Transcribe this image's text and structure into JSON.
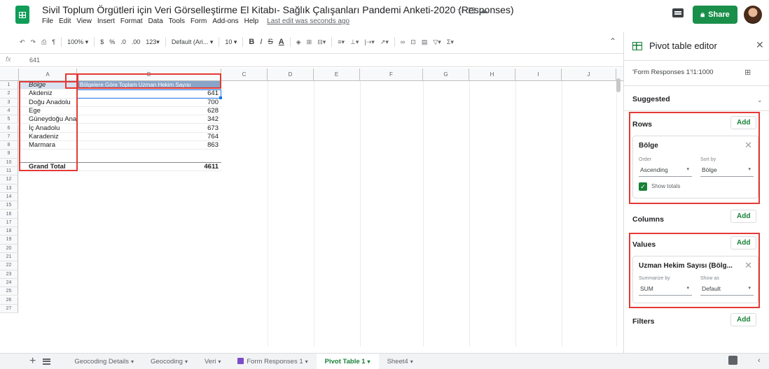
{
  "header": {
    "title": "Sivil Toplum Örgütleri için Veri Görselleştirme El Kitabı- Sağlık Çalışanları Pandemi Anketi-2020 (Responses)",
    "menu": [
      "File",
      "Edit",
      "View",
      "Insert",
      "Format",
      "Data",
      "Tools",
      "Form",
      "Add-ons",
      "Help"
    ],
    "last_edit": "Last edit was seconds ago",
    "share_label": "Share"
  },
  "toolbar": {
    "zoom": "100%",
    "currency": "$",
    "percent": "%",
    "dec_less": ".0",
    "dec_more": ".00",
    "format_123": "123",
    "font": "Default (Ari...",
    "font_size": "10"
  },
  "formula_bar": {
    "fx": "fx",
    "value": "641"
  },
  "columns": [
    "A",
    "B",
    "C",
    "D",
    "E",
    "F",
    "G",
    "H",
    "I",
    "J"
  ],
  "rows": [
    "1",
    "2",
    "3",
    "4",
    "5",
    "6",
    "7",
    "8",
    "9",
    "10",
    "11",
    "12",
    "13",
    "14",
    "15",
    "16",
    "17",
    "18",
    "19",
    "20",
    "21",
    "22",
    "23",
    "24",
    "25",
    "26",
    "27"
  ],
  "pivot_table": {
    "header_a": "Bölge",
    "header_b": "Bölgelere Göre Toplam Uzman Hekim Sayısı",
    "data": [
      {
        "region": "Akdeniz",
        "value": "641"
      },
      {
        "region": "Doğu Anadolu",
        "value": "700"
      },
      {
        "region": "Ege",
        "value": "628"
      },
      {
        "region": "Güneydoğu Anadolu",
        "value": "342"
      },
      {
        "region": "İç Anadolu",
        "value": "673"
      },
      {
        "region": "Karadeniz",
        "value": "764"
      },
      {
        "region": "Marmara",
        "value": "863"
      }
    ],
    "grand_total_label": "Grand Total",
    "grand_total_value": "4611"
  },
  "sheet_tabs": [
    {
      "label": "Geocoding Details",
      "active": false
    },
    {
      "label": "Geocoding",
      "active": false
    },
    {
      "label": "Veri",
      "active": false
    },
    {
      "label": "Form Responses 1",
      "active": false,
      "form": true
    },
    {
      "label": "Pivot Table 1",
      "active": true
    },
    {
      "label": "Sheet4",
      "active": false
    }
  ],
  "pivot_editor": {
    "title": "Pivot table editor",
    "range": "'Form Responses 1'!1:1000",
    "suggested": "Suggested",
    "add": "Add",
    "rows_section": "Rows",
    "row_field": {
      "name": "Bölge",
      "order_label": "Order",
      "order_value": "Ascending",
      "sortby_label": "Sort by",
      "sortby_value": "Bölge",
      "show_totals": "Show totals"
    },
    "columns_section": "Columns",
    "values_section": "Values",
    "value_field": {
      "name": "Uzman Hekim Sayısı (Bölg...",
      "summarize_label": "Summarize by",
      "summarize_value": "SUM",
      "showas_label": "Show as",
      "showas_value": "Default"
    },
    "filters_section": "Filters"
  },
  "colors": {
    "accent": "#188038",
    "share": "#1a8f4a",
    "highlight": "#e53935",
    "header_row": "#d9e2f0"
  }
}
